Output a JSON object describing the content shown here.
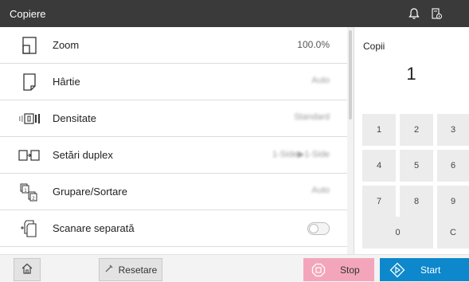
{
  "window": {
    "title": "Copiere"
  },
  "header_icons": [
    "bell-icon",
    "device-info-icon"
  ],
  "settings": {
    "items": [
      {
        "label": "Zoom",
        "value": "100.0%",
        "icon": "zoom-page-icon",
        "obscured": false
      },
      {
        "label": "Hârtie",
        "value": "Auto",
        "icon": "paper-icon",
        "obscured": true
      },
      {
        "label": "Densitate",
        "value": "Standard",
        "icon": "density-icon",
        "obscured": true
      },
      {
        "label": "Setări duplex",
        "value": "1-Side▶1-Side",
        "icon": "duplex-icon",
        "obscured": true
      },
      {
        "label": "Grupare/Sortare",
        "value": "Auto",
        "icon": "group-sort-icon",
        "obscured": true
      },
      {
        "label": "Scanare separată",
        "toggle_on": false,
        "icon": "separate-scan-icon"
      }
    ]
  },
  "copies": {
    "label": "Copii",
    "value": "1"
  },
  "keypad": {
    "keys": [
      "1",
      "2",
      "3",
      "4",
      "5",
      "6",
      "7",
      "8",
      "9",
      "0",
      "C"
    ]
  },
  "bottom": {
    "home_icon": "home-icon",
    "reset_label": "Resetare",
    "stop_label": "Stop",
    "start_label": "Start"
  },
  "colors": {
    "title_bar": "#3a3a3a",
    "stop": "#f3a6bb",
    "start": "#0d88cc",
    "keypad_key": "#ececec"
  }
}
